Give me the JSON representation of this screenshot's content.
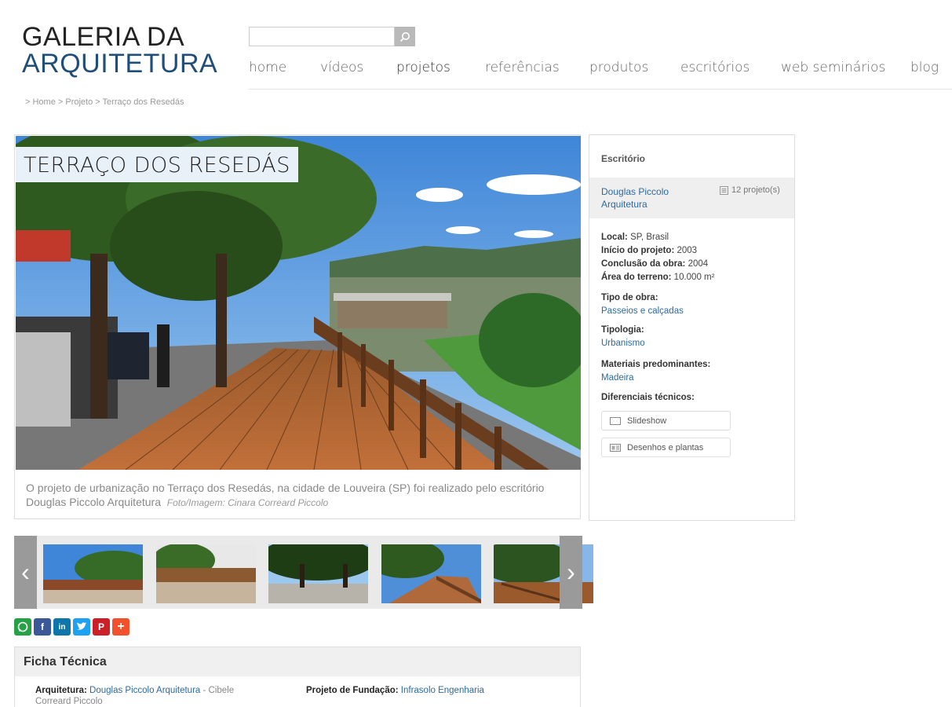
{
  "logo": {
    "line1": "GALERIA DA",
    "line2": "ARQUITETURA"
  },
  "search": {
    "placeholder": ""
  },
  "nav": [
    "home",
    "vídeos",
    "projetos",
    "referências",
    "produtos",
    "escritórios",
    "web seminários",
    "blog"
  ],
  "nav_active": "projetos",
  "breadcrumb": "> Home > Projeto > Terraço dos Resedás",
  "project": {
    "title": "TERRAÇO DOS RESEDÁS",
    "caption": "O projeto de urbanização no Terraço dos Resedás, na cidade de Louveira (SP) foi realizado pelo escritório Douglas Piccolo Arquitetura",
    "credit": "Foto/Imagem:  Cinara Correard Piccolo"
  },
  "sidebar": {
    "office_heading": "Escritório",
    "office_name": "Douglas Piccolo Arquitetura",
    "office_count": "12 projeto(s)",
    "local_label": "Local:",
    "local_value": "SP, Brasil",
    "inicio_label": "Início do projeto:",
    "inicio_value": "2003",
    "conclusao_label": "Conclusão da obra:",
    "conclusao_value": "2004",
    "area_label": "Área do terreno:",
    "area_value": "10.000 m²",
    "tipo_label": "Tipo de obra:",
    "tipo_value": "Passeios e calçadas",
    "tipologia_label": "Tipologia:",
    "tipologia_value": "Urbanismo",
    "materiais_label": "Materiais predominantes:",
    "materiais_value": "Madeira",
    "diferenciais_label": "Diferenciais técnicos:",
    "pill_slideshow": "Slideshow",
    "pill_desenhos": "Desenhos e plantas"
  },
  "share_icons": [
    "whatsapp-icon",
    "facebook-icon",
    "linkedin-icon",
    "twitter-icon",
    "pinterest-icon",
    "plus-icon"
  ],
  "ficha": {
    "heading": "Ficha Técnica",
    "arq_label": "Arquitetura:",
    "arq_value": "Douglas Piccolo Arquitetura",
    "arq_extra": " - Cibele Correard Piccolo",
    "fund_label": "Projeto de Fundação:",
    "fund_value": "Infrasolo Engenharia"
  },
  "colors": {
    "brand_blue": "#1f4e79",
    "link": "#2d6a9f",
    "title_bg": "#e8f1f8"
  }
}
